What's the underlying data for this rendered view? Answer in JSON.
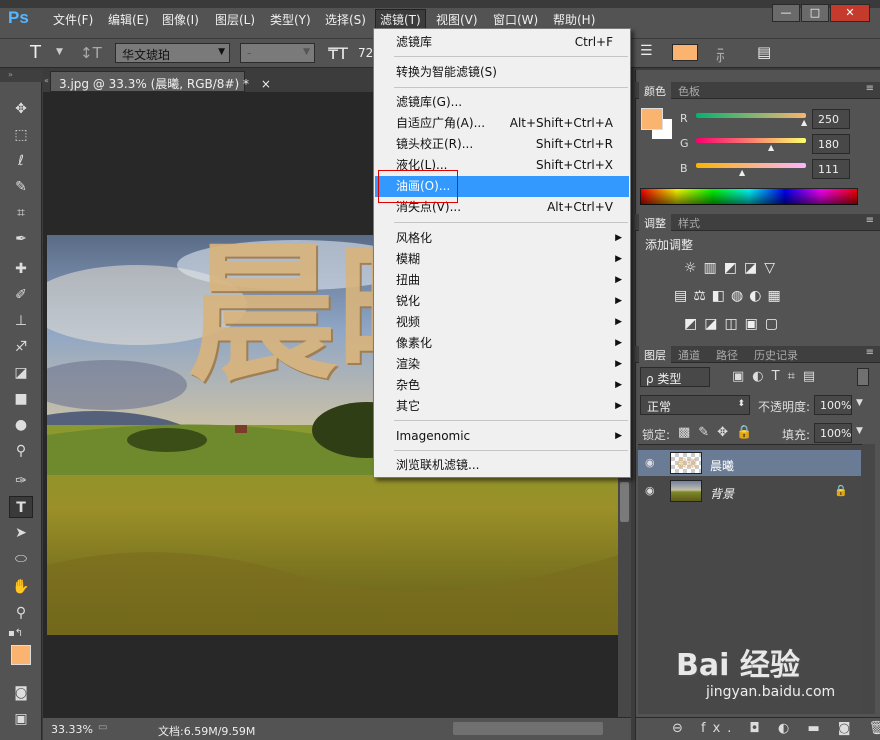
{
  "app": {
    "logo": "Ps"
  },
  "menubar": {
    "items": [
      "文件(F)",
      "编辑(E)",
      "图像(I)",
      "图层(L)",
      "类型(Y)",
      "选择(S)",
      "滤镜(T)",
      "视图(V)",
      "窗口(W)",
      "帮助(H)"
    ],
    "window_buttons": [
      "—",
      "□",
      "✕"
    ]
  },
  "options": {
    "tool_glyph": "T",
    "font_family": "华文琥珀",
    "font_style": "-",
    "font_size": "72"
  },
  "document": {
    "tab_title": "3.jpg @ 33.3% (晨曦, RGB/8#) *",
    "tab_close": "×",
    "overlay_text": "晨曦",
    "zoom": "33.33%",
    "doc_size": "文档:6.59M/9.59M"
  },
  "filter_menu": {
    "items": [
      {
        "label": "滤镜库",
        "shortcut": "Ctrl+F"
      },
      {
        "label": "转换为智能滤镜(S)",
        "shortcut": ""
      },
      {
        "label": "滤镜库(G)...",
        "shortcut": ""
      },
      {
        "label": "自适应广角(A)...",
        "shortcut": "Alt+Shift+Ctrl+A"
      },
      {
        "label": "镜头校正(R)...",
        "shortcut": "Shift+Ctrl+R"
      },
      {
        "label": "液化(L)...",
        "shortcut": "Shift+Ctrl+X"
      },
      {
        "label": "油画(O)...",
        "shortcut": ""
      },
      {
        "label": "消失点(V)...",
        "shortcut": "Alt+Ctrl+V"
      },
      {
        "label": "风格化",
        "shortcut": ""
      },
      {
        "label": "模糊",
        "shortcut": ""
      },
      {
        "label": "扭曲",
        "shortcut": ""
      },
      {
        "label": "锐化",
        "shortcut": ""
      },
      {
        "label": "视频",
        "shortcut": ""
      },
      {
        "label": "像素化",
        "shortcut": ""
      },
      {
        "label": "渲染",
        "shortcut": ""
      },
      {
        "label": "杂色",
        "shortcut": ""
      },
      {
        "label": "其它",
        "shortcut": ""
      },
      {
        "label": "Imagenomic",
        "shortcut": ""
      },
      {
        "label": "浏览联机滤镜...",
        "shortcut": ""
      }
    ],
    "highlighted": "油画(O)..."
  },
  "color_panel": {
    "tabs": [
      "颜色",
      "色板"
    ],
    "r_label": "R",
    "g_label": "G",
    "b_label": "B",
    "r": "250",
    "g": "180",
    "b": "111",
    "foreground": "#fab46f"
  },
  "adjust_panel": {
    "tabs": [
      "调整",
      "样式"
    ],
    "title": "添加调整"
  },
  "layers_panel": {
    "tabs": [
      "图层",
      "通道",
      "路径",
      "历史记录"
    ],
    "filter_kind": "ρ 类型",
    "blend_mode": "正常",
    "opacity_label": "不透明度:",
    "opacity": "100%",
    "lock_label": "锁定:",
    "fill_label": "填充:",
    "fill": "100%",
    "layers": [
      {
        "name": "晨曦",
        "selected": true
      },
      {
        "name": "背景",
        "selected": false
      }
    ],
    "footer_icons": "⊖ fx. ◘ ◐ ▬ ◙ 🗑"
  },
  "watermark": {
    "text": "Bai 经验",
    "url": "jingyan.baidu.com"
  }
}
